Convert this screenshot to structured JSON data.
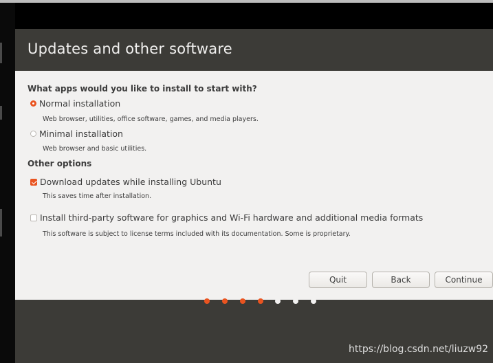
{
  "window": {
    "title": "Updates and other software"
  },
  "install_question": "What apps would you like to install to start with?",
  "install_options": [
    {
      "label": "Normal installation",
      "description": "Web browser, utilities, office software, games, and media players.",
      "selected": true
    },
    {
      "label": "Minimal installation",
      "description": "Web browser and basic utilities.",
      "selected": false
    }
  ],
  "other_options_heading": "Other options",
  "other_options": [
    {
      "label": "Download updates while installing Ubuntu",
      "description": "This saves time after installation.",
      "checked": true
    },
    {
      "label": "Install third-party software for graphics and Wi-Fi hardware and additional media formats",
      "description": "This software is subject to license terms included with its documentation. Some is proprietary.",
      "checked": false
    }
  ],
  "buttons": {
    "quit": "Quit",
    "back": "Back",
    "continue": "Continue"
  },
  "progress": {
    "total_steps": 7,
    "completed_steps": 4,
    "accent_color": "#e95420"
  },
  "watermark": "https://blog.csdn.net/liuzw92"
}
